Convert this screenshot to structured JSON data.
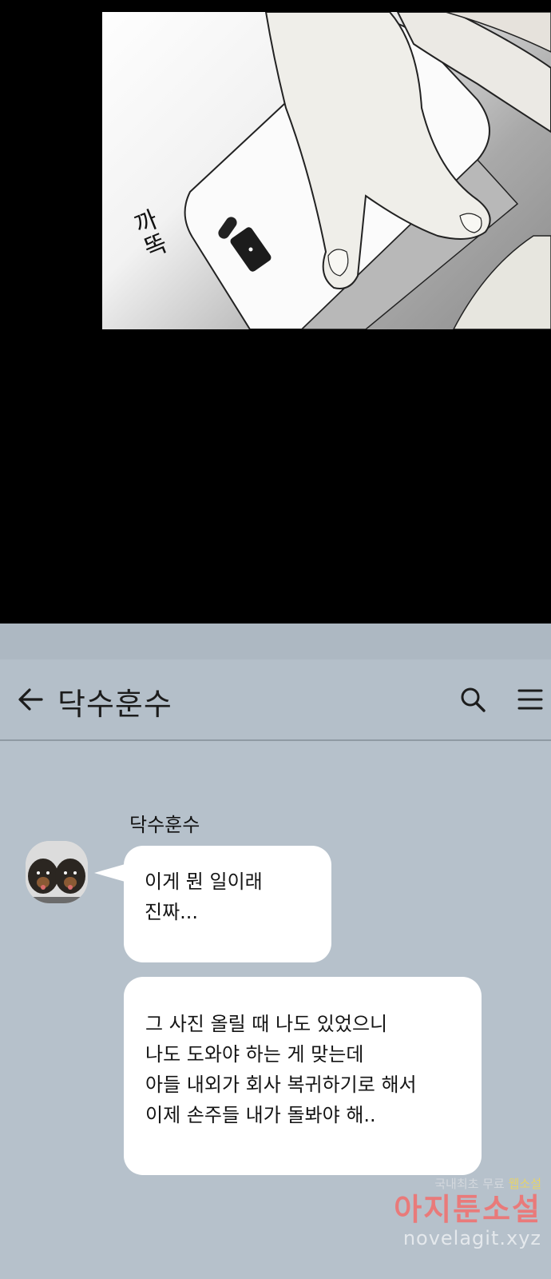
{
  "comic_panel": {
    "sfx_text": "까똑"
  },
  "chat": {
    "title": "닥수훈수",
    "sender_name": "닥수훈수",
    "messages": [
      {
        "text": "이게 뭔 일이래\n진짜..."
      },
      {
        "text": "그 사진 올릴 때 나도 있었으니\n나도 도와야 하는 게 맞는데\n아들 내외가 회사 복귀하기로 해서\n이제 손주들 내가 돌봐야 해.."
      }
    ],
    "icons": {
      "back": "arrow-left-icon",
      "search": "search-icon",
      "menu": "hamburger-menu-icon"
    }
  },
  "watermark": {
    "tagline_a": "국내최초 무료",
    "tagline_b": "웹소설",
    "brand": "아지툰소설",
    "url": "novelagit.xyz"
  }
}
